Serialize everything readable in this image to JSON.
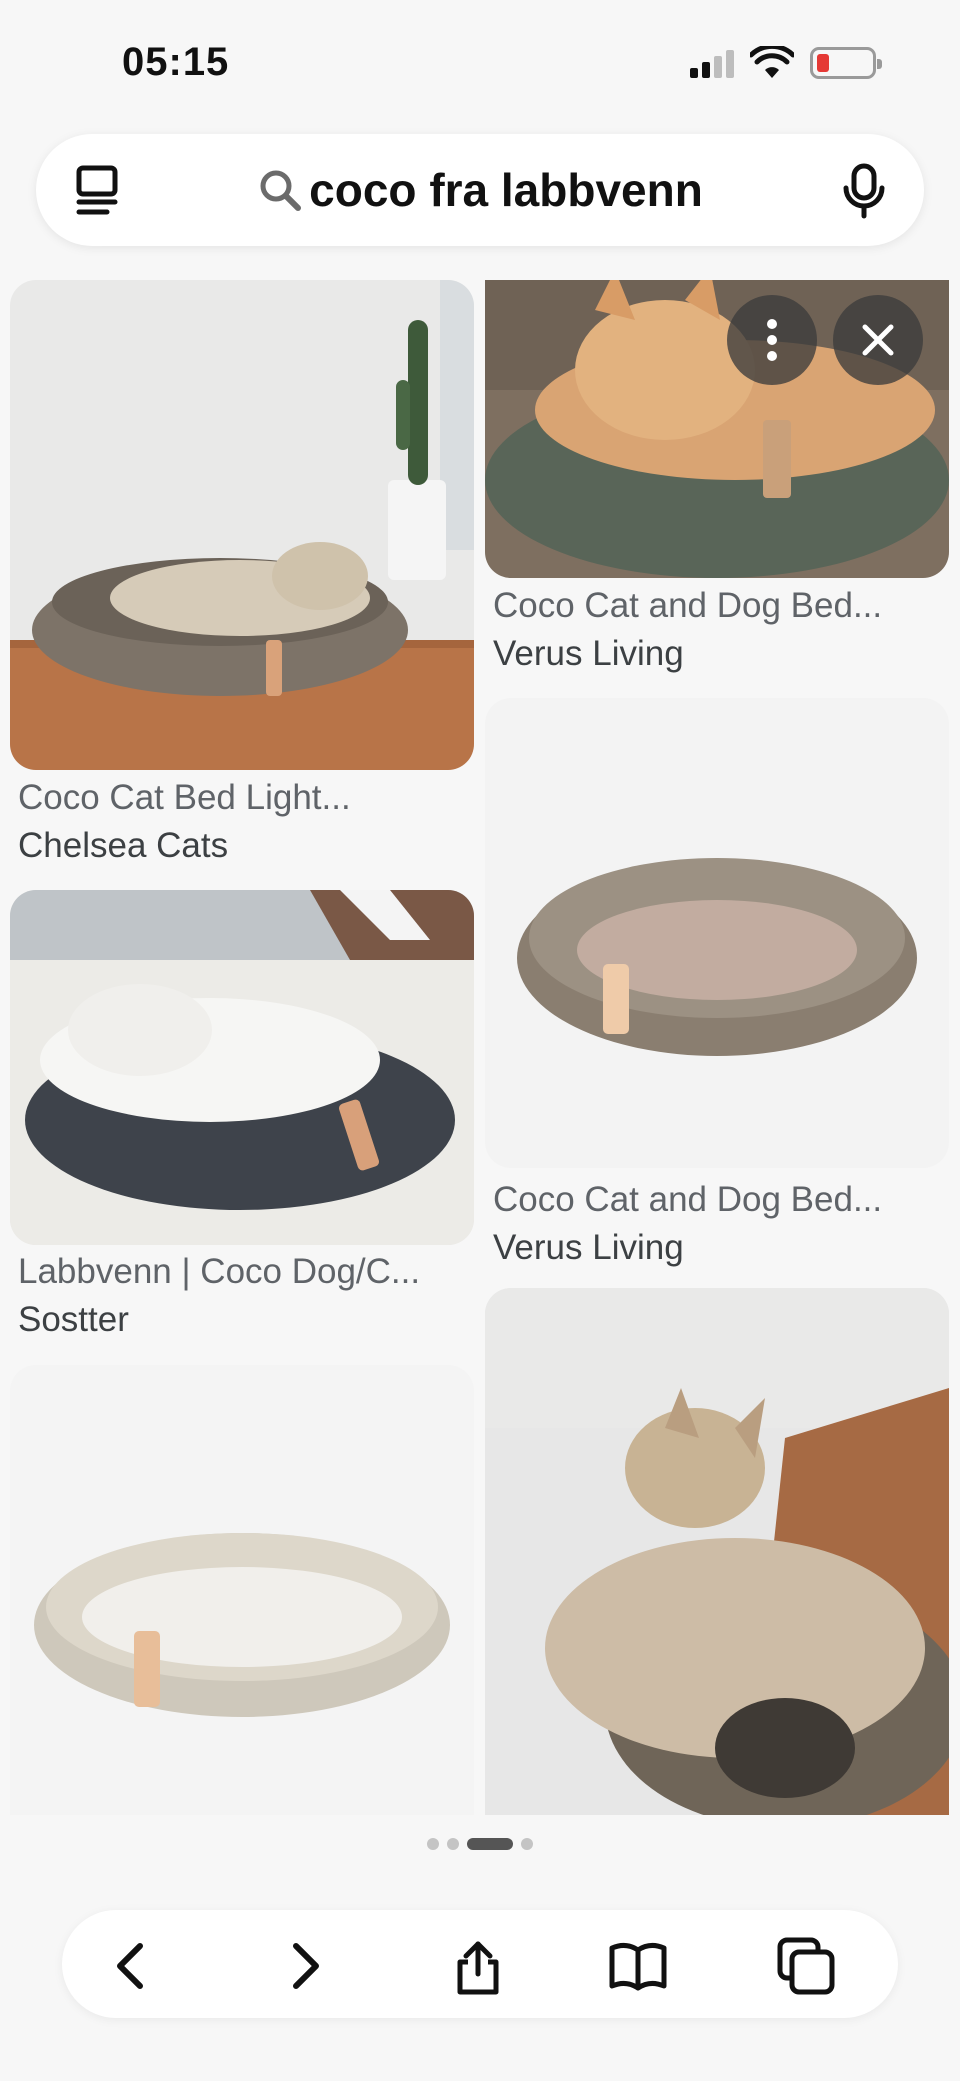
{
  "status_bar": {
    "time": "05:15",
    "icons": [
      "cellular-signal-icon",
      "wifi-icon",
      "battery-low-icon"
    ],
    "battery_color": "#e53935"
  },
  "search": {
    "query": "coco fra labbvenn",
    "left_icon": "tabs-overview-icon",
    "right_icon": "microphone-icon"
  },
  "results": [
    {
      "title": "Coco Cat Bed Light...",
      "source": "Chelsea Cats",
      "image": "tabby cat lying in taupe crochet bed on wooden floor"
    },
    {
      "title": "Coco Cat and Dog Bed...",
      "source": "Verus Living",
      "image": "ginger cat in dark green crochet bed"
    },
    {
      "title": "Labbvenn | Coco Dog/C...",
      "source": "Sostter",
      "image": "white cat sleeping in dark grey crochet bed"
    },
    {
      "title": "Coco Cat and Dog Bed...",
      "source": "Verus Living",
      "image": "taupe crochet round bed product shot"
    },
    {
      "title": "",
      "source": "",
      "image": "cream crochet round bed product shot"
    },
    {
      "title": "",
      "source": "",
      "image": "bengal cat sleeping in taupe crochet bed"
    }
  ],
  "overlay": {
    "more_icon": "more-vertical-icon",
    "close_icon": "close-icon"
  },
  "pager": {
    "count": 4,
    "active_index": 2
  },
  "toolbar": {
    "buttons": [
      "back-icon",
      "forward-icon",
      "share-icon",
      "bookmarks-icon",
      "tabs-icon"
    ]
  }
}
